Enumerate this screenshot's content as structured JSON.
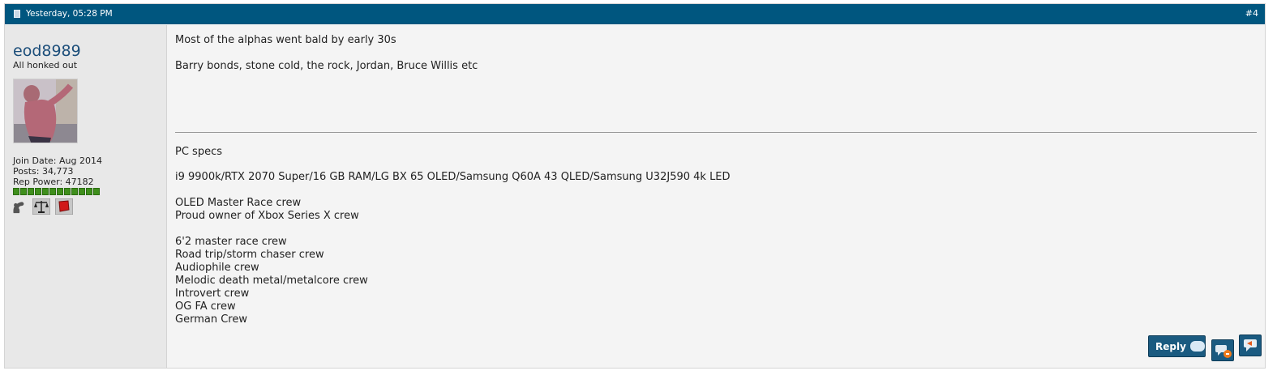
{
  "header": {
    "date": "Yesterday, 05:28 PM",
    "post_number": "#4"
  },
  "user": {
    "username": "eod8989",
    "title": "All honked out",
    "join_date": "Join Date: Aug 2014",
    "posts": "Posts: 34,773",
    "rep_power": "Rep Power: 47182",
    "rep_pips": 12
  },
  "post": {
    "lines": [
      "Most of the alphas went bald by early 30s",
      "Barry bonds, stone cold, the rock, Jordan, Bruce Willis etc"
    ]
  },
  "signature": {
    "lines": [
      "PC specs",
      "i9 9900k/RTX 2070 Super/16 GB RAM/LG BX 65 OLED/Samsung Q60A 43 QLED/Samsung U32J590 4k LED",
      "OLED Master Race crew",
      "Proud owner of Xbox Series X crew",
      "6'2 master race crew",
      "Road trip/storm chaser crew",
      "Audiophile crew",
      "Melodic death metal/metalcore crew",
      "Introvert crew",
      "OG FA crew",
      "German Crew"
    ]
  },
  "buttons": {
    "reply": "Reply"
  },
  "icons": [
    "document-icon",
    "muscle-icon",
    "scales-icon",
    "flag-icon",
    "speech-bubble-icon",
    "multiquote-icon",
    "quote-icon"
  ],
  "colors": {
    "header": "#00567f",
    "username": "#1c4e7a",
    "rep": "#3f8f1c",
    "button": "#1a5a80"
  }
}
